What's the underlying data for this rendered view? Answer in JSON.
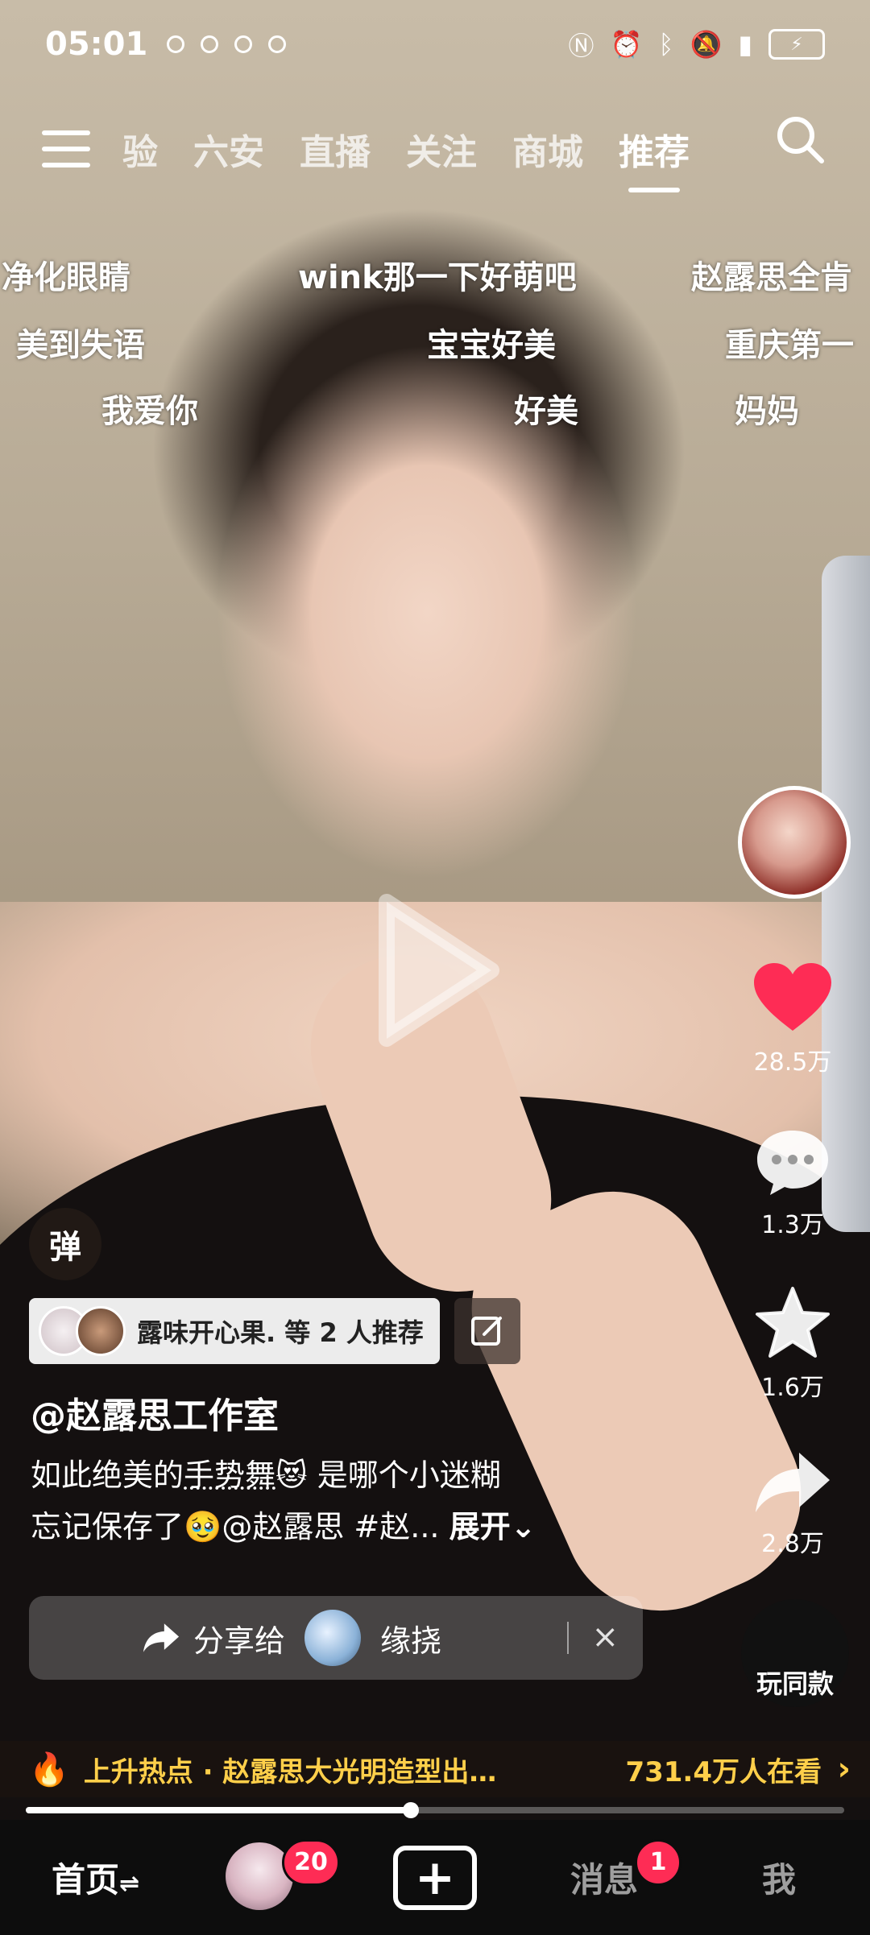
{
  "status_bar": {
    "time": "05:01",
    "network_icons": [
      "nfc-icon",
      "alarm-icon",
      "bluetooth-icon",
      "mute-icon",
      "signal-icon"
    ],
    "battery_icon": "battery-charging-icon"
  },
  "top_nav": {
    "menu_icon": "hamburger-menu-icon",
    "tabs": [
      {
        "label": "验",
        "active": false
      },
      {
        "label": "六安",
        "active": false
      },
      {
        "label": "直播",
        "active": false
      },
      {
        "label": "关注",
        "active": false
      },
      {
        "label": "商城",
        "active": false
      },
      {
        "label": "推荐",
        "active": true
      }
    ],
    "search_icon": "search-icon"
  },
  "danmaku": [
    "净化眼睛",
    "wink那一下好萌吧",
    "赵露思全肯",
    "美到失语",
    "宝宝好美",
    "重庆第一",
    "我爱你",
    "好美",
    "妈妈"
  ],
  "side_actions": {
    "like_count": "28.5万",
    "comment_count": "1.3万",
    "favorite_count": "1.6万",
    "share_count": "2.8万",
    "play_same_label": "玩同款"
  },
  "video_info": {
    "danmaku_toggle": "弹",
    "recommend_text": "露味开心果. 等 2 人推荐",
    "author": "@赵露思工作室",
    "desc_line1_pre": "如此绝美的",
    "desc_line1_underline": "手势舞",
    "desc_line1_post": "😻 是哪个小迷糊",
    "desc_line2": "忘记保存了🥹@赵露思 #赵...",
    "expand_label": "展开"
  },
  "share_bar": {
    "label": "分享给",
    "target_name": "缘挠",
    "close_label": "×"
  },
  "hot_bar": {
    "text": "上升热点 · 赵露思大光明造型出…",
    "viewers": "731.4万人在看"
  },
  "progress": {
    "fraction": 0.47
  },
  "bottom_nav": {
    "home_label": "首页",
    "home_suffix": "⇌",
    "friend_badge": "20",
    "add_label": "+",
    "message_label": "消息",
    "message_badge": "1",
    "me_label": "我"
  },
  "colors": {
    "like": "#fe2c55",
    "badge": "#fe2c55",
    "hot_text": "#ffcf4a"
  }
}
